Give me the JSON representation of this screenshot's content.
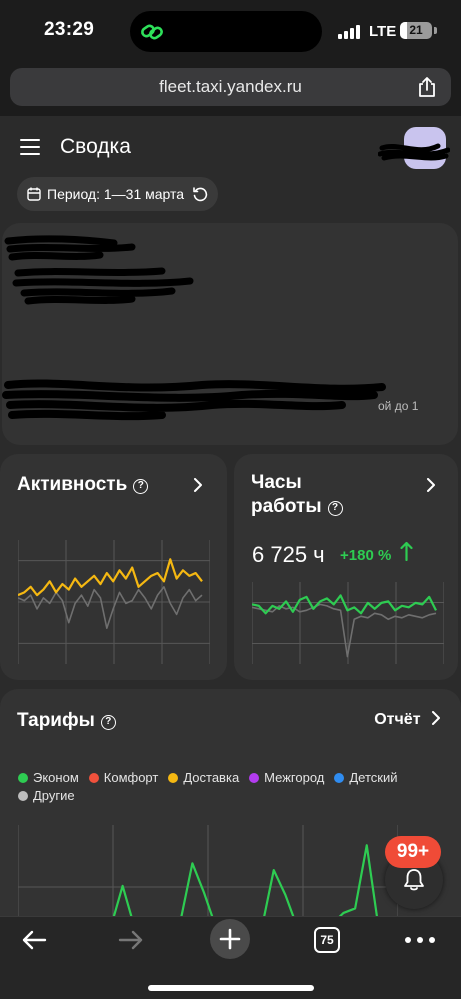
{
  "status_bar": {
    "time": "23:29",
    "network": "LTE",
    "battery": "21"
  },
  "browser": {
    "url": "fleet.taxi.yandex.ru",
    "tab_count": "75",
    "icons": {
      "back": "arrow-left-icon",
      "forward": "arrow-right-icon",
      "new_tab": "plus-icon",
      "tabs": "tabs-icon",
      "more": "more-dots-icon",
      "share": "share-icon"
    }
  },
  "header": {
    "title": "Сводка",
    "period_label": "Период: 1—31 марта"
  },
  "redacted_card": {
    "visible_fragment": "ой до 1"
  },
  "activity_card": {
    "title": "Активность",
    "help": "?",
    "series_colors": {
      "current": "#f5b812",
      "previous": "#6f6f6f"
    },
    "chart_data": {
      "type": "line",
      "series": [
        {
          "values": [
            20,
            22,
            26,
            20,
            24,
            30,
            22,
            28,
            24,
            32,
            26,
            30,
            34,
            28,
            36,
            30,
            38,
            32,
            40,
            26,
            30,
            34,
            36,
            30,
            46,
            32,
            38,
            34,
            36,
            30
          ]
        },
        {
          "values": [
            18,
            16,
            20,
            10,
            18,
            14,
            22,
            16,
            0,
            14,
            20,
            12,
            24,
            18,
            -4,
            10,
            22,
            14,
            16,
            24,
            18,
            10,
            20,
            26,
            14,
            6,
            18,
            24,
            16,
            20
          ]
        }
      ],
      "ylim": [
        -30,
        60
      ],
      "grid": true
    }
  },
  "hours_card": {
    "title_line1": "Часы",
    "title_line2": "работы",
    "help": "?",
    "value": "6 725 ч",
    "delta": "+180 %",
    "series_colors": {
      "current": "#2ecc52",
      "previous": "#6f6f6f"
    },
    "chart_data": {
      "type": "line",
      "series": [
        {
          "values": [
            30,
            28,
            18,
            28,
            24,
            34,
            20,
            36,
            40,
            24,
            34,
            38,
            30,
            42,
            22,
            26,
            18,
            32,
            24,
            32,
            34,
            22,
            28,
            26,
            32,
            30,
            40,
            22
          ]
        },
        {
          "values": [
            26,
            24,
            22,
            20,
            28,
            24,
            26,
            20,
            22,
            26,
            30,
            28,
            24,
            22,
            -40,
            10,
            14,
            12,
            18,
            16,
            10,
            14,
            12,
            16,
            14,
            12,
            16,
            18
          ]
        }
      ],
      "ylim": [
        -50,
        60
      ],
      "grid": true
    }
  },
  "tariffs_card": {
    "title": "Тарифы",
    "help": "?",
    "report_label": "Отчёт",
    "legend": [
      {
        "label": "Эконом",
        "color": "#2ecc52"
      },
      {
        "label": "Комфорт",
        "color": "#f0513c"
      },
      {
        "label": "Доставка",
        "color": "#f5b812"
      },
      {
        "label": "Межгород",
        "color": "#b33cf0"
      },
      {
        "label": "Детский",
        "color": "#2f8cf0"
      },
      {
        "label": "Другие",
        "color": "#bdbdbd"
      }
    ],
    "chart_data": {
      "type": "line",
      "series": [
        {
          "values": [
            0,
            0,
            0,
            0,
            0,
            0,
            0,
            0,
            0,
            36,
            0,
            0,
            0,
            0,
            6,
            56,
            30,
            0,
            0,
            0,
            0,
            0,
            50,
            28,
            0,
            0,
            6,
            2,
            12,
            16,
            72,
            0,
            0
          ]
        }
      ],
      "ylim": [
        -20,
        90
      ],
      "grid": true
    }
  },
  "notifications": {
    "badge": "99+",
    "icon": "bell-icon"
  }
}
